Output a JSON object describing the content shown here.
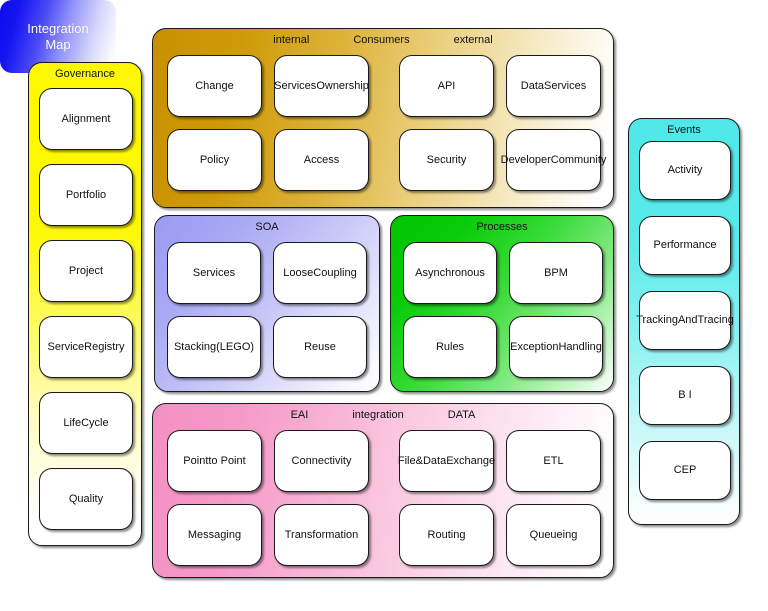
{
  "diagram": {
    "title": "Integration Map",
    "badge": {
      "name": "integration-map-badge",
      "label_line1": "Integration",
      "label_line2": "Map",
      "color": "#0a0af0"
    },
    "panels": [
      {
        "id": "governance",
        "titles": [
          "Governance"
        ],
        "color": "#fdf800",
        "layout": "column",
        "cards": [
          {
            "lines": [
              "Alignment"
            ]
          },
          {
            "lines": [
              "Portfolio"
            ]
          },
          {
            "lines": [
              "Project"
            ]
          },
          {
            "lines": [
              "Service",
              "Registry"
            ]
          },
          {
            "lines": [
              "LifeCycle"
            ]
          },
          {
            "lines": [
              "Quality"
            ]
          }
        ]
      },
      {
        "id": "consumers",
        "titles": [
          "internal",
          "Consumers",
          "external"
        ],
        "color": "#c89000",
        "layout": "grid-4x2",
        "cards": [
          {
            "lines": [
              "Change"
            ]
          },
          {
            "lines": [
              "Services",
              "Ownership"
            ]
          },
          {
            "lines": [
              "API"
            ]
          },
          {
            "lines": [
              "DataServices"
            ]
          },
          {
            "lines": [
              "Policy"
            ]
          },
          {
            "lines": [
              "Access"
            ]
          },
          {
            "lines": [
              "Security"
            ]
          },
          {
            "lines": [
              "Developer",
              "Community"
            ]
          }
        ]
      },
      {
        "id": "soa",
        "titles": [
          "SOA"
        ],
        "color": "#9a9af2",
        "layout": "grid-2x2",
        "cards": [
          {
            "lines": [
              "Services"
            ]
          },
          {
            "lines": [
              "Loose",
              "Coupling"
            ]
          },
          {
            "lines": [
              "Stacking",
              "(LEGO)"
            ]
          },
          {
            "lines": [
              "Reuse"
            ]
          }
        ]
      },
      {
        "id": "processes",
        "titles": [
          "Processes"
        ],
        "color": "#00c400",
        "layout": "grid-2x2",
        "cards": [
          {
            "lines": [
              "Asynchronous"
            ]
          },
          {
            "lines": [
              "BPM"
            ]
          },
          {
            "lines": [
              "Rules"
            ]
          },
          {
            "lines": [
              "Exception",
              "Handling"
            ]
          }
        ]
      },
      {
        "id": "eai",
        "titles": [
          "EAI",
          "integration",
          "DATA"
        ],
        "color": "#f390c2",
        "layout": "grid-4x2",
        "cards": [
          {
            "lines": [
              "Point",
              "to Point"
            ]
          },
          {
            "lines": [
              "Connectivity"
            ]
          },
          {
            "lines": [
              "File&",
              "DataExchange"
            ]
          },
          {
            "lines": [
              "ETL"
            ]
          },
          {
            "lines": [
              "Messaging"
            ]
          },
          {
            "lines": [
              "Transformation"
            ]
          },
          {
            "lines": [
              "Routing"
            ]
          },
          {
            "lines": [
              "Queueing"
            ]
          }
        ]
      },
      {
        "id": "events",
        "titles": [
          "Events"
        ],
        "color": "#4fe8e8",
        "layout": "column",
        "cards": [
          {
            "lines": [
              "Activity"
            ]
          },
          {
            "lines": [
              "Performance"
            ]
          },
          {
            "lines": [
              "Tracking",
              "AndTracing"
            ]
          },
          {
            "lines": [
              "B I"
            ]
          },
          {
            "lines": [
              "CEP"
            ]
          }
        ]
      }
    ]
  }
}
